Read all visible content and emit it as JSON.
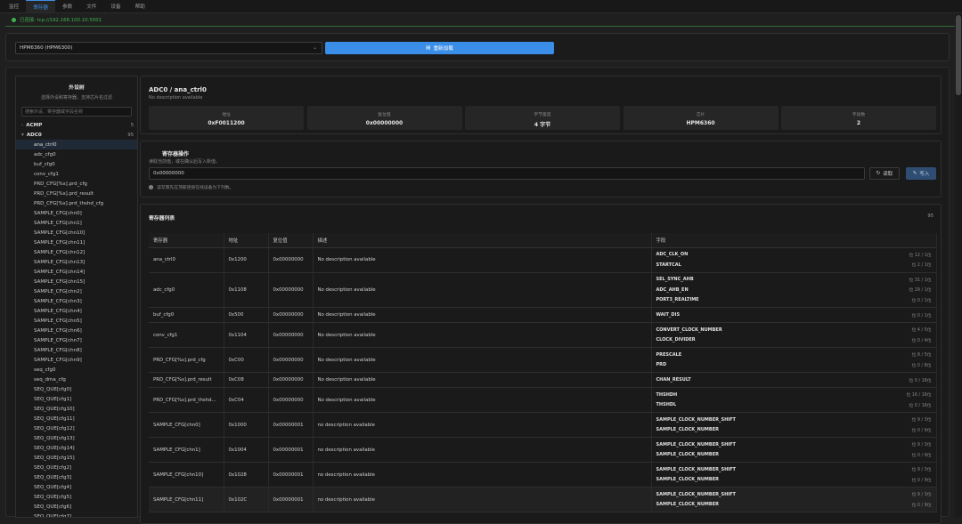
{
  "nav": {
    "tabs": [
      "监控",
      "寄存器",
      "参数",
      "文件",
      "设备",
      "帮助"
    ],
    "active": 1
  },
  "status": {
    "text": "已连接: tcp://192.168.100.10:5001",
    "color": "#3fb24f"
  },
  "chip_select": {
    "value": "HPM6360 (HPM6300)"
  },
  "reload_button": {
    "icon": "file-icon",
    "label": "重新加载"
  },
  "sidebar": {
    "title": "外设树",
    "subtitle": "选择外设和寄存器，支持芯片名过滤",
    "search_placeholder": "搜索外设、寄存器或字段名称",
    "groups": [
      {
        "name": "ACMP",
        "count": "5",
        "expanded": false
      },
      {
        "name": "ADC0",
        "count": "95",
        "expanded": true
      }
    ],
    "items": [
      "ana_ctrl0",
      "adc_cfg0",
      "buf_cfg0",
      "conv_cfg1",
      "PRD_CFG[%s].prd_cfg",
      "PRD_CFG[%s].prd_result",
      "PRD_CFG[%s].prd_thshd_cfg",
      "SAMPLE_CFG[chn0]",
      "SAMPLE_CFG[chn1]",
      "SAMPLE_CFG[chn10]",
      "SAMPLE_CFG[chn11]",
      "SAMPLE_CFG[chn12]",
      "SAMPLE_CFG[chn13]",
      "SAMPLE_CFG[chn14]",
      "SAMPLE_CFG[chn15]",
      "SAMPLE_CFG[chn2]",
      "SAMPLE_CFG[chn3]",
      "SAMPLE_CFG[chn4]",
      "SAMPLE_CFG[chn5]",
      "SAMPLE_CFG[chn6]",
      "SAMPLE_CFG[chn7]",
      "SAMPLE_CFG[chn8]",
      "SAMPLE_CFG[chn9]",
      "seq_cfg0",
      "seq_dma_cfg",
      "SEQ_QUE[cfg0]",
      "SEQ_QUE[cfg1]",
      "SEQ_QUE[cfg10]",
      "SEQ_QUE[cfg11]",
      "SEQ_QUE[cfg12]",
      "SEQ_QUE[cfg13]",
      "SEQ_QUE[cfg14]",
      "SEQ_QUE[cfg15]",
      "SEQ_QUE[cfg2]",
      "SEQ_QUE[cfg3]",
      "SEQ_QUE[cfg4]",
      "SEQ_QUE[cfg5]",
      "SEQ_QUE[cfg6]",
      "SEQ_QUE[cfg7]"
    ],
    "active_item": 0
  },
  "header": {
    "title": "ADC0 / ana_ctrl0",
    "description": "No description available",
    "stats": [
      {
        "label": "地址",
        "value": "0xF0011200"
      },
      {
        "label": "复位值",
        "value": "0x00000000"
      },
      {
        "label": "字节宽度",
        "value": "4 字节"
      },
      {
        "label": "芯片",
        "value": "HPM6360"
      },
      {
        "label": "字段数",
        "value": "2"
      }
    ]
  },
  "register_op": {
    "title": "寄存器操作",
    "subtitle": "读取当前值，或在确认后写入新值。",
    "input_value": "0x00000000",
    "read_label": "读取",
    "write_label": "写入",
    "hint": "读写需先在顶部连接在线设备为下列数。"
  },
  "register_list": {
    "title": "寄存器列表",
    "count": "95",
    "columns": [
      "寄存器",
      "地址",
      "复位值",
      "描述",
      "字段"
    ],
    "rows": [
      {
        "name": "ana_ctrl0",
        "addr": "0x1200",
        "reset": "0x00000000",
        "desc": "No description available",
        "fields": [
          {
            "n": "ADC_CLK_ON",
            "b": "位 12 / 1位"
          },
          {
            "n": "STARTCAL",
            "b": "位 2 / 1位"
          }
        ]
      },
      {
        "name": "adc_cfg0",
        "addr": "0x1108",
        "reset": "0x00000000",
        "desc": "No description available",
        "fields": [
          {
            "n": "SEL_SYNC_AHB",
            "b": "位 31 / 1位"
          },
          {
            "n": "ADC_AHB_EN",
            "b": "位 29 / 1位"
          },
          {
            "n": "PORT3_REALTIME",
            "b": "位 0 / 1位"
          }
        ]
      },
      {
        "name": "buf_cfg0",
        "addr": "0x500",
        "reset": "0x00000000",
        "desc": "No description available",
        "fields": [
          {
            "n": "WAIT_DIS",
            "b": "位 0 / 1位"
          }
        ]
      },
      {
        "name": "conv_cfg1",
        "addr": "0x1104",
        "reset": "0x00000000",
        "desc": "No description available",
        "fields": [
          {
            "n": "CONVERT_CLOCK_NUMBER",
            "b": "位 4 / 5位"
          },
          {
            "n": "CLOCK_DIVIDER",
            "b": "位 0 / 4位"
          }
        ]
      },
      {
        "name": "PRD_CFG[%s].prd_cfg",
        "addr": "0xC00",
        "reset": "0x00000000",
        "desc": "No description available",
        "fields": [
          {
            "n": "PRESCALE",
            "b": "位 8 / 5位"
          },
          {
            "n": "PRD",
            "b": "位 0 / 8位"
          }
        ]
      },
      {
        "name": "PRD_CFG[%s].prd_result",
        "addr": "0xC08",
        "reset": "0x00000000",
        "desc": "No description available",
        "fields": [
          {
            "n": "CHAN_RESULT",
            "b": "位 0 / 16位"
          }
        ]
      },
      {
        "name": "PRD_CFG[%s].prd_thshd...",
        "addr": "0xC04",
        "reset": "0x00000000",
        "desc": "No description available",
        "fields": [
          {
            "n": "THSHDH",
            "b": "位 16 / 16位"
          },
          {
            "n": "THSHDL",
            "b": "位 0 / 16位"
          }
        ]
      },
      {
        "name": "SAMPLE_CFG[chn0]",
        "addr": "0x1000",
        "reset": "0x00000001",
        "desc": "no description available",
        "fields": [
          {
            "n": "SAMPLE_CLOCK_NUMBER_SHIFT",
            "b": "位 9 / 3位"
          },
          {
            "n": "SAMPLE_CLOCK_NUMBER",
            "b": "位 0 / 9位"
          }
        ]
      },
      {
        "name": "SAMPLE_CFG[chn1]",
        "addr": "0x1004",
        "reset": "0x00000001",
        "desc": "no description available",
        "fields": [
          {
            "n": "SAMPLE_CLOCK_NUMBER_SHIFT",
            "b": "位 9 / 3位"
          },
          {
            "n": "SAMPLE_CLOCK_NUMBER",
            "b": "位 0 / 9位"
          }
        ]
      },
      {
        "name": "SAMPLE_CFG[chn10]",
        "addr": "0x1028",
        "reset": "0x00000001",
        "desc": "no description available",
        "fields": [
          {
            "n": "SAMPLE_CLOCK_NUMBER_SHIFT",
            "b": "位 9 / 3位"
          },
          {
            "n": "SAMPLE_CLOCK_NUMBER",
            "b": "位 0 / 9位"
          }
        ]
      },
      {
        "name": "SAMPLE_CFG[chn11]",
        "addr": "0x102C",
        "reset": "0x00000001",
        "desc": "no description available",
        "fields": [
          {
            "n": "SAMPLE_CLOCK_NUMBER_SHIFT",
            "b": "位 9 / 3位"
          },
          {
            "n": "SAMPLE_CLOCK_NUMBER",
            "b": "位 0 / 9位"
          }
        ]
      }
    ]
  }
}
